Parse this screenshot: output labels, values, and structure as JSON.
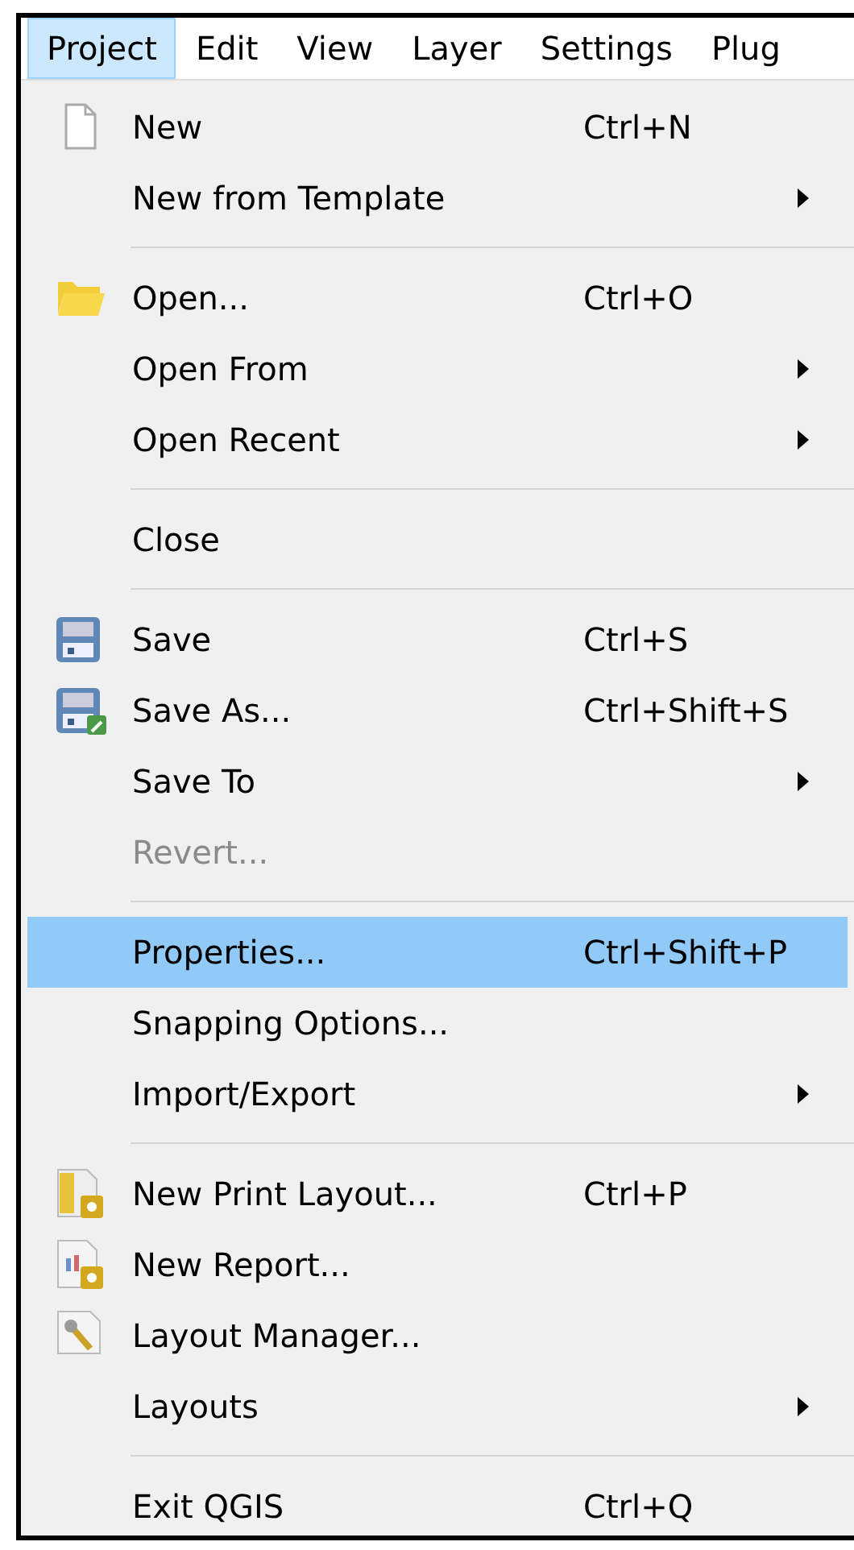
{
  "menubar": [
    {
      "label": "Project",
      "selected": true
    },
    {
      "label": "Edit",
      "selected": false
    },
    {
      "label": "View",
      "selected": false
    },
    {
      "label": "Layer",
      "selected": false
    },
    {
      "label": "Settings",
      "selected": false
    },
    {
      "label": "Plug",
      "selected": false
    }
  ],
  "menu": [
    {
      "kind": "item",
      "label": "New",
      "shortcut": "Ctrl+N",
      "submenu": false,
      "disabled": false,
      "selected": false
    },
    {
      "kind": "item",
      "label": "New from Template",
      "submenu": true,
      "disabled": false,
      "selected": false
    },
    {
      "kind": "separator"
    },
    {
      "kind": "item",
      "label": "Open...",
      "shortcut": "Ctrl+O",
      "submenu": false,
      "disabled": false,
      "selected": false
    },
    {
      "kind": "item",
      "label": "Open From",
      "submenu": true,
      "disabled": false,
      "selected": false
    },
    {
      "kind": "item",
      "label": "Open Recent",
      "submenu": true,
      "disabled": false,
      "selected": false
    },
    {
      "kind": "separator"
    },
    {
      "kind": "item",
      "label": "Close",
      "submenu": false,
      "disabled": false,
      "selected": false
    },
    {
      "kind": "separator"
    },
    {
      "kind": "item",
      "label": "Save",
      "shortcut": "Ctrl+S",
      "submenu": false,
      "disabled": false,
      "selected": false
    },
    {
      "kind": "item",
      "label": "Save As...",
      "shortcut": "Ctrl+Shift+S",
      "submenu": false,
      "disabled": false,
      "selected": false
    },
    {
      "kind": "item",
      "label": "Save To",
      "submenu": true,
      "disabled": false,
      "selected": false
    },
    {
      "kind": "item",
      "label": "Revert...",
      "submenu": false,
      "disabled": true,
      "selected": false
    },
    {
      "kind": "separator"
    },
    {
      "kind": "item",
      "label": "Properties...",
      "shortcut": "Ctrl+Shift+P",
      "submenu": false,
      "disabled": false,
      "selected": true
    },
    {
      "kind": "item",
      "label": "Snapping Options...",
      "submenu": false,
      "disabled": false,
      "selected": false
    },
    {
      "kind": "item",
      "label": "Import/Export",
      "submenu": true,
      "disabled": false,
      "selected": false
    },
    {
      "kind": "separator"
    },
    {
      "kind": "item",
      "label": "New Print Layout...",
      "shortcut": "Ctrl+P",
      "submenu": false,
      "disabled": false,
      "selected": false
    },
    {
      "kind": "item",
      "label": "New Report...",
      "submenu": false,
      "disabled": false,
      "selected": false
    },
    {
      "kind": "item",
      "label": "Layout Manager...",
      "submenu": false,
      "disabled": false,
      "selected": false
    },
    {
      "kind": "item",
      "label": "Layouts",
      "submenu": true,
      "disabled": false,
      "selected": false
    },
    {
      "kind": "separator"
    },
    {
      "kind": "item",
      "label": "Exit QGIS",
      "shortcut": "Ctrl+Q",
      "submenu": false,
      "disabled": false,
      "selected": false
    }
  ]
}
